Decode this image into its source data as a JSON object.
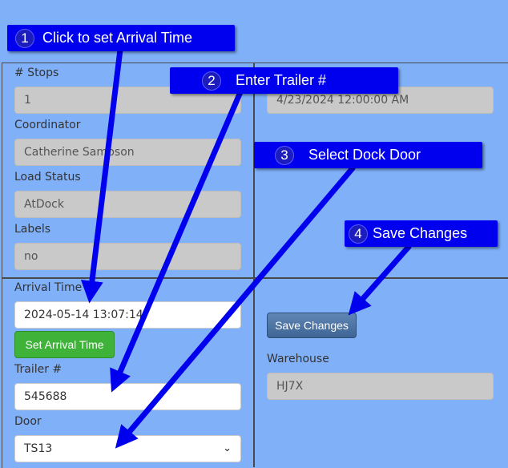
{
  "left_top": {
    "stops_label": "# Stops",
    "stops_value": "1",
    "coordinator_label": "Coordinator",
    "coordinator_value": "Catherine Sampson",
    "load_status_label": "Load Status",
    "load_status_value": "AtDock",
    "labels_label": "Labels",
    "labels_value": "no"
  },
  "right_top": {
    "date_value": "4/23/2024 12:00:00 AM"
  },
  "left_bottom": {
    "arrival_time_label": "Arrival Time",
    "arrival_time_value": "2024-05-14 13:07:14",
    "set_arrival_button": "Set Arrival Time",
    "trailer_label": "Trailer #",
    "trailer_value": "545688",
    "door_label": "Door",
    "door_selected": "TS13"
  },
  "right_bottom": {
    "save_button": "Save Changes",
    "warehouse_label": "Warehouse",
    "warehouse_value": "HJ7X"
  },
  "callouts": [
    {
      "num": "1",
      "text": "Click to set Arrival Time"
    },
    {
      "num": "2",
      "text": "Enter Trailer #"
    },
    {
      "num": "3",
      "text": "Select Dock Door"
    },
    {
      "num": "4",
      "text": "Save Changes"
    }
  ],
  "colors": {
    "background": "#7fb0f8",
    "callout": "#0000ee",
    "green_button": "#3fb23a",
    "save_button": "#4a72a4"
  }
}
